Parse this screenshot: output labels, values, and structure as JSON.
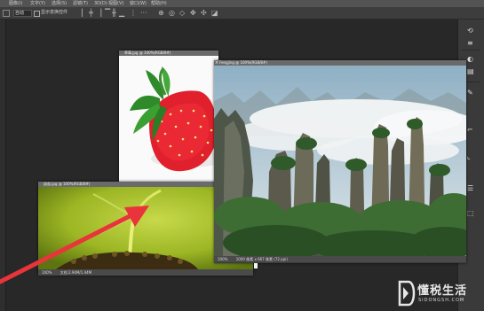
{
  "menubar": {
    "items": [
      "图像(I)",
      "文字(Y)",
      "选择(S)",
      "滤镜(T)",
      "3D(D)",
      "视图(V)",
      "窗口(W)",
      "帮助(H)"
    ]
  },
  "optionsbar": {
    "size_value": "自动",
    "checkbox_label": "显示变换控件"
  },
  "documents": {
    "strawberry": {
      "title": "草莓.jpg @ 100%(RGB/8#)"
    },
    "sprout": {
      "title": "幼苗.jpg @ 100%(RGB/8#)",
      "zoom": "100%",
      "info": "文档:2.94M/1.44M"
    },
    "mountain": {
      "title": "Fengjing @ 100%(RGB/8#)",
      "zoom": "100%",
      "info": "1000 像素 x 667 像素 (72 ppi)"
    }
  },
  "watermark": {
    "text": "懂税生活",
    "sub": "SIDONGSH.COM"
  },
  "colors": {
    "arrow": "#e8343a",
    "tab": "#6a6a6a",
    "workspace": "#282828"
  }
}
